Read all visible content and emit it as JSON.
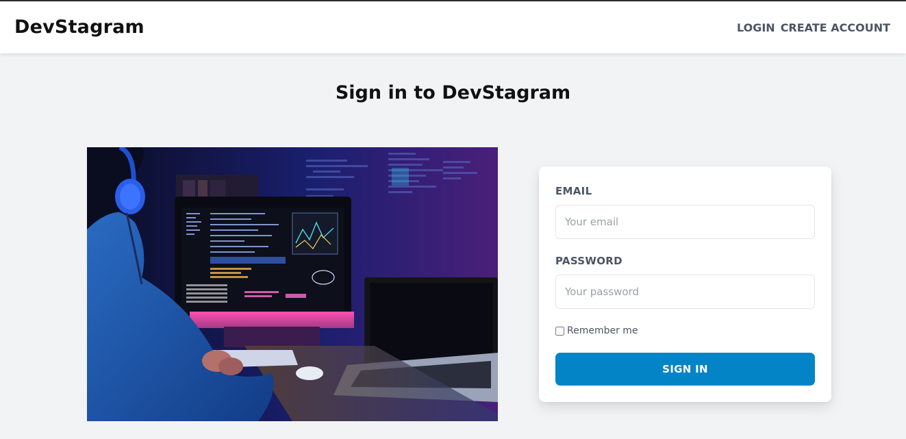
{
  "header": {
    "logo": "DevStagram",
    "nav": {
      "login": "LOGIN",
      "create_account": "CREATE ACCOUNT"
    }
  },
  "main": {
    "title": "Sign in to DevStagram",
    "form": {
      "email_label": "EMAIL",
      "email_placeholder": "Your email",
      "email_value": "",
      "password_label": "PASSWORD",
      "password_placeholder": "Your password",
      "password_value": "",
      "remember_label": "Remember me",
      "remember_checked": false,
      "submit_label": "SIGN IN"
    }
  },
  "colors": {
    "accent": "#0284c7",
    "background": "#f2f3f5",
    "label": "#4b5563"
  }
}
